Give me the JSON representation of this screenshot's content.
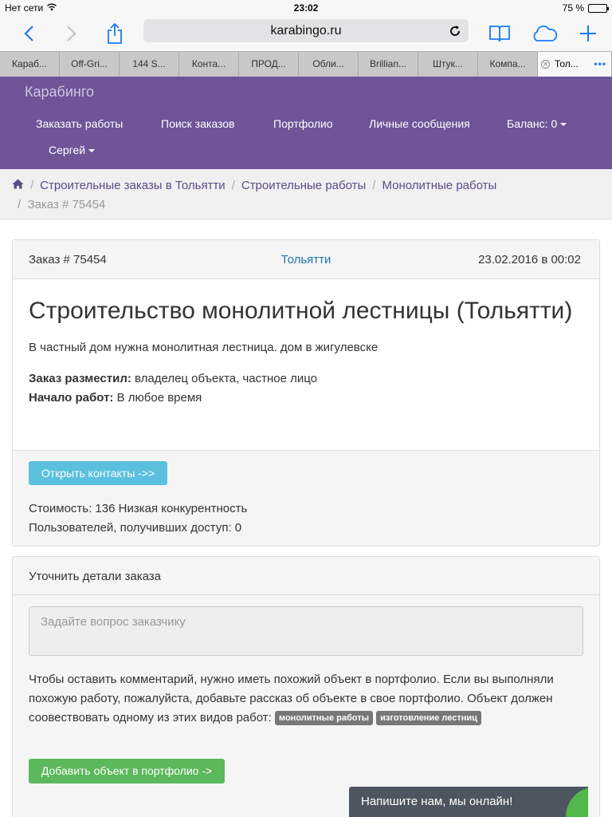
{
  "status": {
    "carrier": "Нет сети",
    "time": "23:02",
    "battery_text": "75 %",
    "battery_level": 0.75
  },
  "browser": {
    "url": "karabingo.ru",
    "tabs": [
      "Караб...",
      "Off-Gri...",
      "144 S...",
      "Конта...",
      "ПРОД...",
      "Обли...",
      "Brillian...",
      "Штук...",
      "Компа..."
    ],
    "active_tab": "Тол..."
  },
  "navbar": {
    "brand": "Карабинго",
    "items": {
      "order_work": "Заказать работы",
      "search_orders": "Поиск заказов",
      "portfolio": "Портфолио",
      "messages": "Личные сообщения",
      "balance": "Баланс: 0",
      "user": "Сергей"
    }
  },
  "breadcrumb": {
    "items": [
      "Строительные заказы в Тольятти",
      "Строительные работы",
      "Монолитные работы"
    ],
    "current": "Заказ # 75454"
  },
  "order": {
    "number": "Заказ # 75454",
    "city": "Тольятти",
    "date": "23.02.2016 в 00:02",
    "title": "Строительство монолитной лестницы (Тольятти)",
    "description": "В частный дом нужна монолитная лестница. дом в жигулевске",
    "placed_by_label": "Заказ разместил:",
    "placed_by_value": "владелец объекта, частное лицо",
    "start_label": "Начало работ:",
    "start_value": "В любое время",
    "open_contacts_button": "Открыть контакты ->>",
    "cost": "Стоимость: 136 Низкая конкурентность",
    "users_access": "Пользователей, получивших доступ: 0"
  },
  "details": {
    "header": "Уточнить детали заказа",
    "question_placeholder": "Задайте вопрос заказчику",
    "notice": "Чтобы оставить комментарий, нужно иметь похожий объект в портфолио. Если вы выполняли похожую работу, пожалуйста, добавьте рассказ об объекте в свое портфолио. Объект должен соовествовать одному из этих видов работ:",
    "tags": [
      "монолитные работы",
      "изготовление лестниц"
    ],
    "add_button": "Добавить объект в портфолио ->"
  },
  "chat": {
    "label": "Напишите нам, мы онлайн!"
  },
  "colors": {
    "navbar": "#6f5498",
    "link": "#5b4a8a",
    "info_button": "#5bc0de",
    "success_button": "#5cb85c",
    "ios_blue": "#1a7cf6",
    "chat_bg": "#4d5560"
  },
  "icons": {
    "wifi": "wifi-icon",
    "back": "back-chevron-icon",
    "forward": "forward-chevron-icon",
    "share": "share-icon",
    "reload": "reload-icon",
    "bookmarks": "bookmarks-icon",
    "icloud": "cloud-icon",
    "new_tab": "plus-icon",
    "home": "home-icon"
  }
}
